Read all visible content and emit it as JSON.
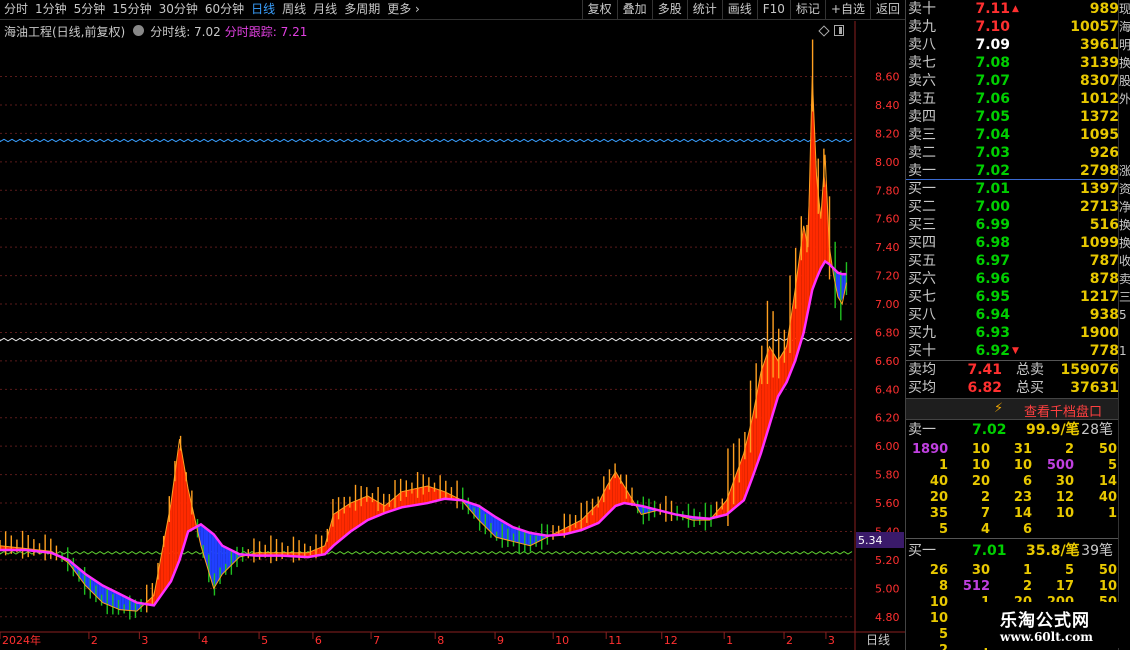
{
  "toolbar": {
    "period_tabs": [
      "分时",
      "1分钟",
      "5分钟",
      "15分钟",
      "30分钟",
      "60分钟",
      "日线",
      "周线",
      "月线",
      "多周期",
      "更多"
    ],
    "active_tab": "日线",
    "right_tools": [
      "复权",
      "叠加",
      "多股",
      "统计",
      "画线",
      "F10",
      "标记",
      "+自选",
      "返回"
    ]
  },
  "stock": {
    "title": "海油工程(日线,前复权)",
    "line_label": "分时线: 7.02",
    "track_label": "分时跟踪: 7.21"
  },
  "chart_data": {
    "type": "line",
    "title": "海油工程(日线,前复权)",
    "xlabel": "",
    "ylabel": "",
    "ylim": [
      4.7,
      8.85
    ],
    "y_ticks": [
      4.8,
      5.0,
      5.2,
      5.4,
      5.6,
      5.8,
      6.0,
      6.2,
      6.4,
      6.6,
      6.8,
      7.0,
      7.2,
      7.4,
      7.6,
      7.8,
      8.0,
      8.2,
      8.4,
      8.6
    ],
    "x_ticks": [
      "2024年",
      "2",
      "3",
      "4",
      "5",
      "6",
      "7",
      "8",
      "9",
      "10",
      "11",
      "12",
      "1",
      "2",
      "3"
    ],
    "x_tick_pos": [
      0,
      0.104,
      0.163,
      0.233,
      0.303,
      0.366,
      0.434,
      0.509,
      0.579,
      0.647,
      0.709,
      0.774,
      0.847,
      0.917,
      0.966
    ],
    "marker_value": "5.34",
    "period_label": "日线",
    "reference_lines": [
      {
        "value": 8.15,
        "color": "#3aa0ff"
      },
      {
        "value": 6.75,
        "color": "#e8e8e8"
      },
      {
        "value": 5.25,
        "color": "#60d030"
      }
    ],
    "price_path": [
      [
        0.0,
        5.3
      ],
      [
        0.03,
        5.28
      ],
      [
        0.06,
        5.26
      ],
      [
        0.08,
        5.18
      ],
      [
        0.1,
        5.02
      ],
      [
        0.12,
        4.9
      ],
      [
        0.14,
        4.85
      ],
      [
        0.16,
        4.84
      ],
      [
        0.18,
        4.95
      ],
      [
        0.2,
        5.6
      ],
      [
        0.21,
        6.05
      ],
      [
        0.22,
        5.7
      ],
      [
        0.235,
        5.3
      ],
      [
        0.25,
        5.0
      ],
      [
        0.26,
        5.1
      ],
      [
        0.28,
        5.22
      ],
      [
        0.3,
        5.25
      ],
      [
        0.33,
        5.25
      ],
      [
        0.36,
        5.25
      ],
      [
        0.38,
        5.3
      ],
      [
        0.39,
        5.52
      ],
      [
        0.41,
        5.6
      ],
      [
        0.43,
        5.65
      ],
      [
        0.45,
        5.58
      ],
      [
        0.47,
        5.68
      ],
      [
        0.5,
        5.72
      ],
      [
        0.52,
        5.68
      ],
      [
        0.54,
        5.62
      ],
      [
        0.56,
        5.48
      ],
      [
        0.58,
        5.36
      ],
      [
        0.6,
        5.33
      ],
      [
        0.62,
        5.3
      ],
      [
        0.64,
        5.36
      ],
      [
        0.66,
        5.42
      ],
      [
        0.68,
        5.48
      ],
      [
        0.7,
        5.6
      ],
      [
        0.71,
        5.72
      ],
      [
        0.72,
        5.82
      ],
      [
        0.73,
        5.72
      ],
      [
        0.75,
        5.52
      ],
      [
        0.77,
        5.55
      ],
      [
        0.79,
        5.52
      ],
      [
        0.81,
        5.48
      ],
      [
        0.83,
        5.48
      ],
      [
        0.85,
        5.62
      ],
      [
        0.87,
        5.95
      ],
      [
        0.88,
        6.2
      ],
      [
        0.89,
        6.52
      ],
      [
        0.9,
        6.7
      ],
      [
        0.91,
        6.6
      ],
      [
        0.92,
        6.7
      ],
      [
        0.93,
        7.1
      ],
      [
        0.94,
        7.55
      ],
      [
        0.945,
        7.4
      ],
      [
        0.95,
        8.6
      ],
      [
        0.955,
        7.9
      ],
      [
        0.96,
        7.6
      ],
      [
        0.965,
        8.05
      ],
      [
        0.97,
        7.4
      ],
      [
        0.975,
        7.2
      ],
      [
        0.98,
        7.05
      ],
      [
        0.985,
        7.0
      ],
      [
        0.99,
        7.15
      ]
    ],
    "ma_path": [
      [
        0.0,
        5.27
      ],
      [
        0.03,
        5.27
      ],
      [
        0.06,
        5.25
      ],
      [
        0.08,
        5.2
      ],
      [
        0.1,
        5.1
      ],
      [
        0.12,
        5.02
      ],
      [
        0.14,
        4.96
      ],
      [
        0.16,
        4.9
      ],
      [
        0.18,
        4.88
      ],
      [
        0.2,
        5.05
      ],
      [
        0.21,
        5.2
      ],
      [
        0.22,
        5.4
      ],
      [
        0.235,
        5.45
      ],
      [
        0.25,
        5.38
      ],
      [
        0.26,
        5.3
      ],
      [
        0.28,
        5.24
      ],
      [
        0.3,
        5.23
      ],
      [
        0.33,
        5.23
      ],
      [
        0.36,
        5.22
      ],
      [
        0.38,
        5.24
      ],
      [
        0.39,
        5.3
      ],
      [
        0.41,
        5.4
      ],
      [
        0.43,
        5.48
      ],
      [
        0.45,
        5.53
      ],
      [
        0.47,
        5.57
      ],
      [
        0.5,
        5.6
      ],
      [
        0.52,
        5.63
      ],
      [
        0.54,
        5.62
      ],
      [
        0.56,
        5.58
      ],
      [
        0.58,
        5.5
      ],
      [
        0.6,
        5.43
      ],
      [
        0.62,
        5.39
      ],
      [
        0.64,
        5.37
      ],
      [
        0.66,
        5.38
      ],
      [
        0.68,
        5.41
      ],
      [
        0.7,
        5.46
      ],
      [
        0.71,
        5.52
      ],
      [
        0.72,
        5.58
      ],
      [
        0.73,
        5.6
      ],
      [
        0.75,
        5.58
      ],
      [
        0.77,
        5.55
      ],
      [
        0.79,
        5.52
      ],
      [
        0.81,
        5.5
      ],
      [
        0.83,
        5.49
      ],
      [
        0.85,
        5.52
      ],
      [
        0.87,
        5.62
      ],
      [
        0.88,
        5.78
      ],
      [
        0.89,
        5.95
      ],
      [
        0.9,
        6.15
      ],
      [
        0.91,
        6.35
      ],
      [
        0.92,
        6.45
      ],
      [
        0.93,
        6.6
      ],
      [
        0.94,
        6.8
      ],
      [
        0.945,
        6.95
      ],
      [
        0.95,
        7.1
      ],
      [
        0.955,
        7.18
      ],
      [
        0.96,
        7.25
      ],
      [
        0.965,
        7.3
      ],
      [
        0.97,
        7.28
      ],
      [
        0.975,
        7.25
      ],
      [
        0.98,
        7.22
      ],
      [
        0.985,
        7.21
      ],
      [
        0.99,
        7.21
      ]
    ],
    "colors": {
      "up_fill": "#ff2a00",
      "down_fill": "#2040ff",
      "ma_line": "#ff30ff",
      "up_wick": "#ffa020",
      "down_wick": "#20c020",
      "grid": "#5a1a1a",
      "axis_text": "#ff3030"
    }
  },
  "book": {
    "asks": [
      {
        "label": "卖十",
        "price": "7.11",
        "vol": "989",
        "color": "red"
      },
      {
        "label": "卖九",
        "price": "7.10",
        "vol": "10057",
        "color": "red"
      },
      {
        "label": "卖八",
        "price": "7.09",
        "vol": "3961",
        "color": "white"
      },
      {
        "label": "卖七",
        "price": "7.08",
        "vol": "3139",
        "color": "green"
      },
      {
        "label": "卖六",
        "price": "7.07",
        "vol": "8307",
        "color": "green"
      },
      {
        "label": "卖五",
        "price": "7.06",
        "vol": "1012",
        "color": "green"
      },
      {
        "label": "卖四",
        "price": "7.05",
        "vol": "1372",
        "color": "green"
      },
      {
        "label": "卖三",
        "price": "7.04",
        "vol": "1095",
        "color": "green"
      },
      {
        "label": "卖二",
        "price": "7.03",
        "vol": "926",
        "color": "green"
      },
      {
        "label": "卖一",
        "price": "7.02",
        "vol": "2798",
        "color": "green"
      }
    ],
    "bids": [
      {
        "label": "买一",
        "price": "7.01",
        "vol": "1397",
        "color": "green"
      },
      {
        "label": "买二",
        "price": "7.00",
        "vol": "2713",
        "color": "green"
      },
      {
        "label": "买三",
        "price": "6.99",
        "vol": "516",
        "color": "green"
      },
      {
        "label": "买四",
        "price": "6.98",
        "vol": "1099",
        "color": "green"
      },
      {
        "label": "买五",
        "price": "6.97",
        "vol": "787",
        "color": "green"
      },
      {
        "label": "买六",
        "price": "6.96",
        "vol": "878",
        "color": "green"
      },
      {
        "label": "买七",
        "price": "6.95",
        "vol": "1217",
        "color": "green"
      },
      {
        "label": "买八",
        "price": "6.94",
        "vol": "938",
        "color": "green"
      },
      {
        "label": "买九",
        "price": "6.93",
        "vol": "1900",
        "color": "green"
      },
      {
        "label": "买十",
        "price": "6.92",
        "vol": "778",
        "color": "green"
      }
    ],
    "avg_sell_label": "卖均",
    "avg_sell": "7.41",
    "total_sell_label": "总卖",
    "total_sell": "159076",
    "avg_buy_label": "买均",
    "avg_buy": "6.82",
    "total_buy_label": "总买",
    "total_buy": "37631",
    "view_qian": "查看千档盘口",
    "queue_sell": {
      "label": "卖一",
      "price": "7.02",
      "pct": "99.9/笔",
      "count": "28笔",
      "rows": [
        [
          "1890",
          "10",
          "31",
          "2",
          "50"
        ],
        [
          "1",
          "10",
          "10",
          "500",
          "5"
        ],
        [
          "40",
          "20",
          "6",
          "30",
          "14"
        ],
        [
          "20",
          "2",
          "23",
          "12",
          "40"
        ],
        [
          "35",
          "7",
          "14",
          "10",
          "1"
        ],
        [
          "5",
          "4",
          "6",
          "",
          ""
        ]
      ]
    },
    "queue_buy": {
      "label": "买一",
      "price": "7.01",
      "pct": "35.8/笔",
      "count": "39笔",
      "rows": [
        [
          "26",
          "30",
          "1",
          "5",
          "50"
        ],
        [
          "8",
          "512",
          "2",
          "17",
          "10"
        ],
        [
          "10",
          "1",
          "20",
          "200",
          "50"
        ],
        [
          "10",
          "1",
          "",
          "",
          ""
        ],
        [
          "5",
          "1",
          "",
          "",
          ""
        ],
        [
          "2",
          "1",
          "",
          "",
          ""
        ]
      ]
    }
  },
  "strip_chars": [
    "现",
    "海",
    "明",
    "换",
    "股",
    "外",
    "",
    "",
    "",
    "涨",
    "资",
    "净",
    "换",
    "换",
    "收",
    "卖",
    "三",
    "5",
    "",
    "1"
  ],
  "watermark": {
    "line1": "乐淘公式网",
    "line2": "www.60lt.com"
  }
}
